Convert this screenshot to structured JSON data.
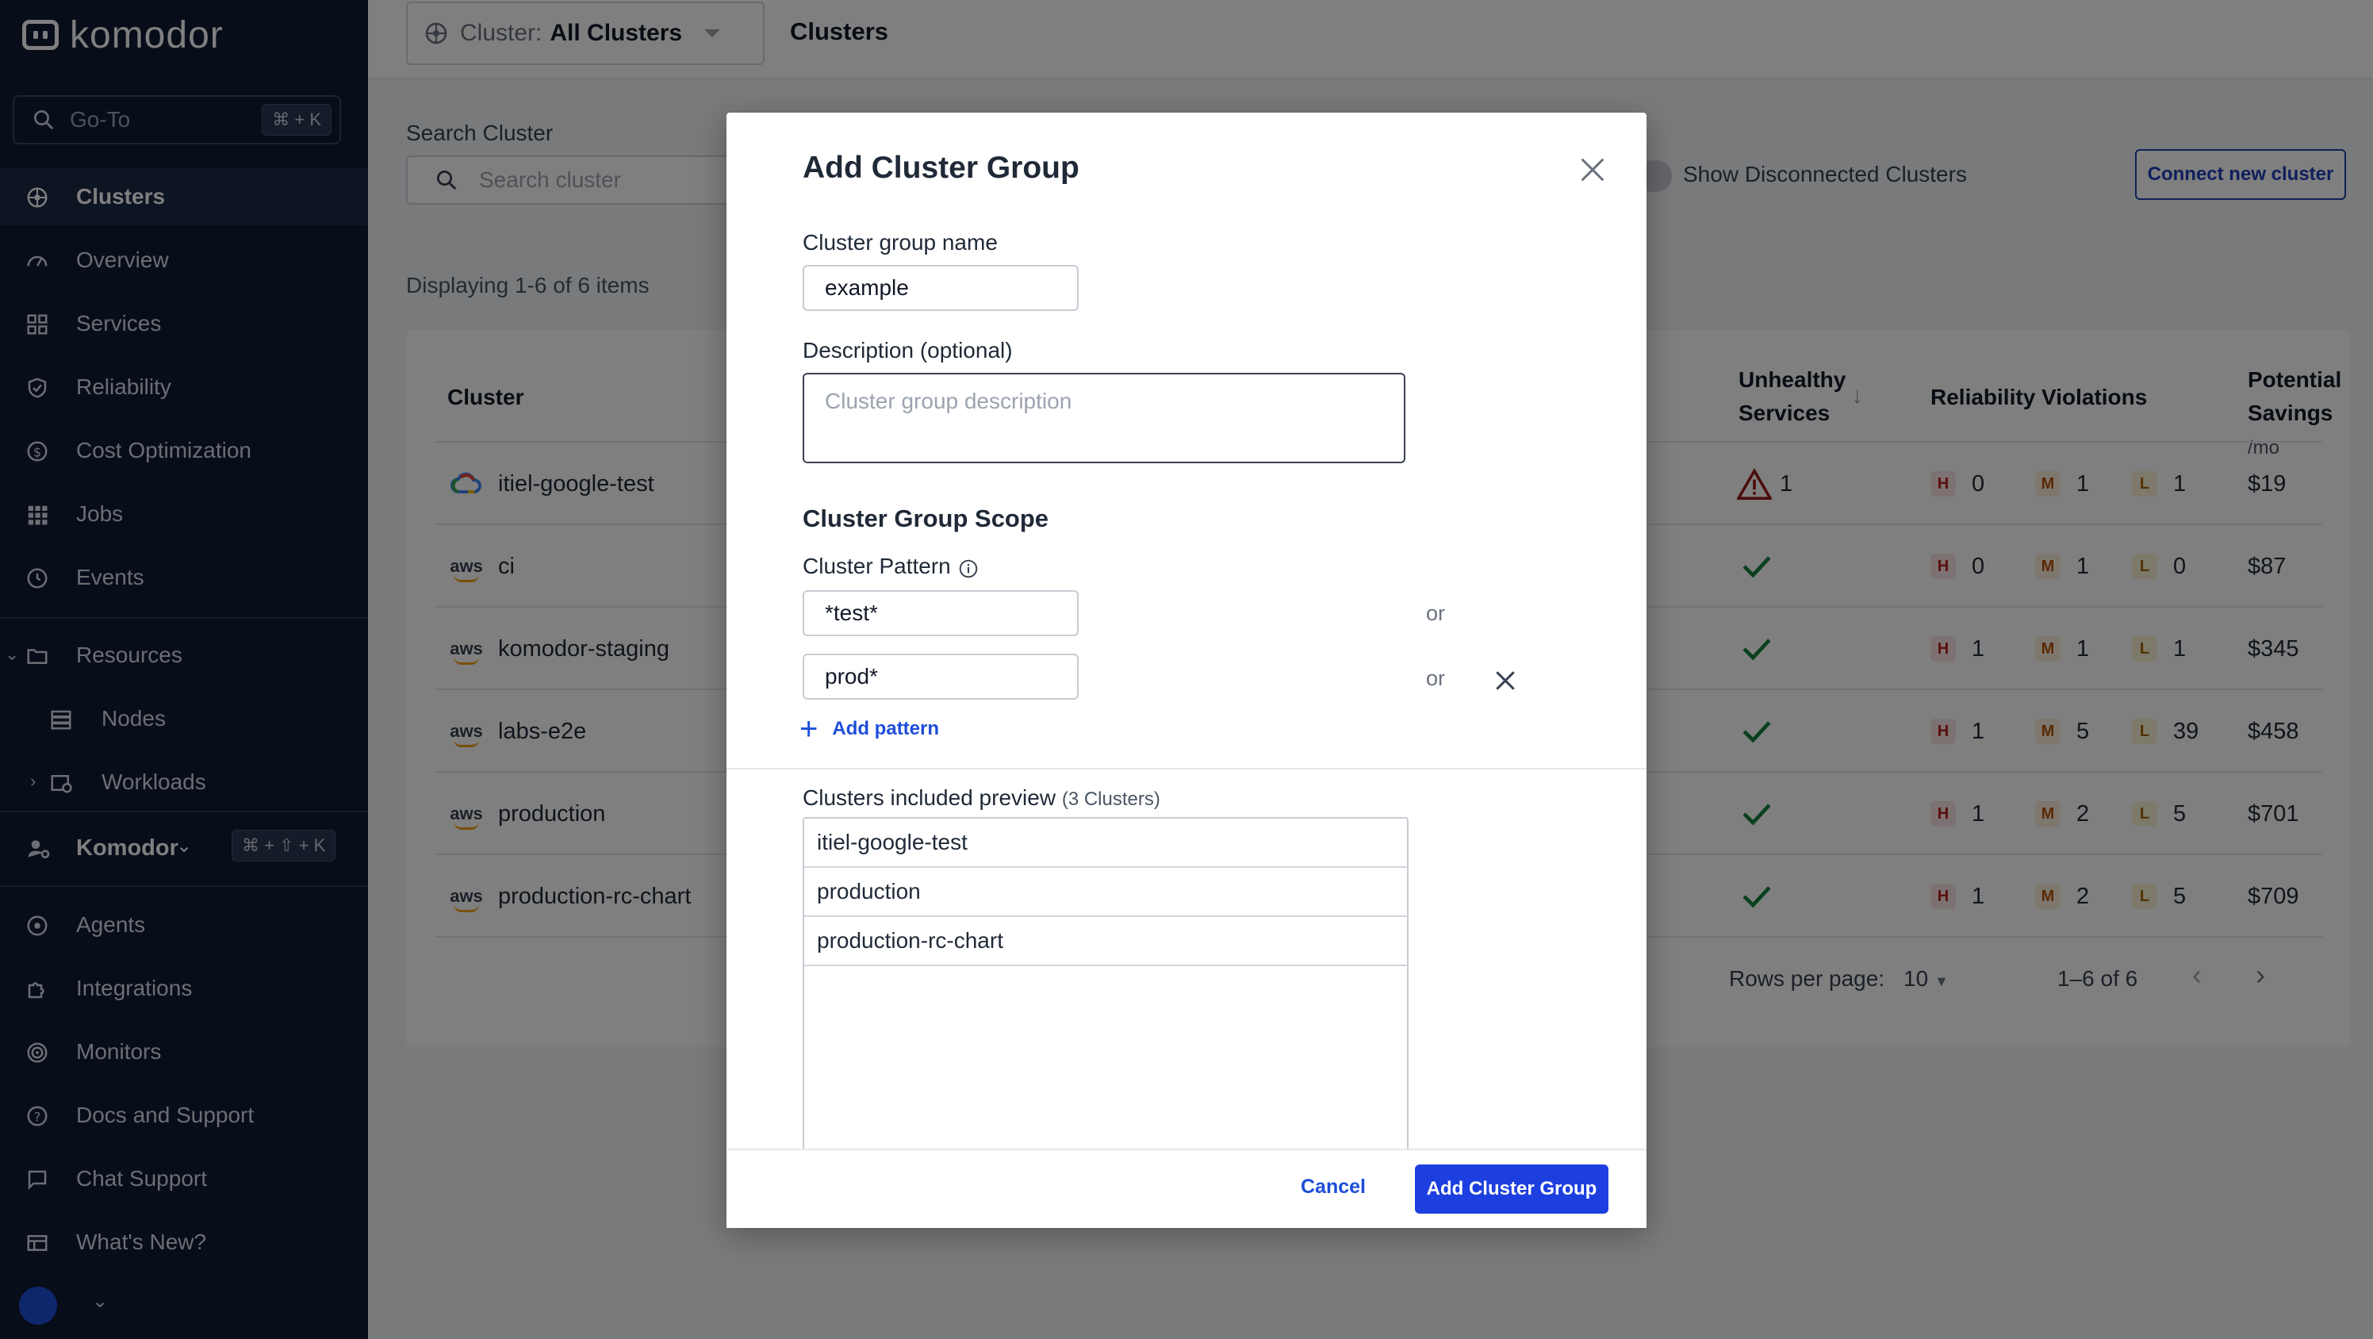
{
  "sidebar": {
    "logo": "komodor",
    "goto": {
      "placeholder": "Go-To",
      "shortcut": "⌘ + K"
    },
    "items": [
      {
        "label": "Clusters",
        "icon": "clusters-icon"
      },
      {
        "label": "Overview",
        "icon": "gauge-icon"
      },
      {
        "label": "Services",
        "icon": "grid-icon"
      },
      {
        "label": "Reliability",
        "icon": "shield-check-icon"
      },
      {
        "label": "Cost Optimization",
        "icon": "dollar-icon"
      },
      {
        "label": "Jobs",
        "icon": "dots-grid-icon"
      },
      {
        "label": "Events",
        "icon": "clock-icon"
      }
    ],
    "resources": {
      "label": "Resources",
      "children": [
        {
          "label": "Nodes"
        },
        {
          "label": "Workloads"
        }
      ]
    },
    "workspace": {
      "label": "Komodor",
      "shortcut": "⌘ + ⇧ + K"
    },
    "bottom_items": [
      {
        "label": "Agents"
      },
      {
        "label": "Integrations"
      },
      {
        "label": "Monitors"
      },
      {
        "label": "Docs and Support"
      },
      {
        "label": "Chat Support"
      },
      {
        "label": "What's New?"
      }
    ]
  },
  "topbar": {
    "cluster_prefix": "Cluster:",
    "cluster_value": "All Clusters",
    "title": "Clusters"
  },
  "filters": {
    "search_label": "Search Cluster",
    "search_placeholder": "Search cluster",
    "show_disconnected": "Show Disconnected Clusters",
    "connect_button": "Connect new cluster"
  },
  "table": {
    "displaying": "Displaying 1-6 of 6 items",
    "headers": {
      "cluster": "Cluster",
      "unhealthy_1": "Unhealthy",
      "unhealthy_2": "Services",
      "violations": "Reliability Violations",
      "savings_1": "Potential",
      "savings_2": "Savings",
      "savings_unit": "/mo"
    },
    "rows": [
      {
        "provider": "gcp",
        "name": "itiel-google-test",
        "unhealthy": "1",
        "h": "0",
        "m": "1",
        "l": "1",
        "savings": "$19"
      },
      {
        "provider": "aws",
        "name": "ci",
        "unhealthy": "",
        "h": "0",
        "m": "1",
        "l": "0",
        "savings": "$87"
      },
      {
        "provider": "aws",
        "name": "komodor-staging",
        "unhealthy": "",
        "h": "1",
        "m": "1",
        "l": "1",
        "savings": "$345"
      },
      {
        "provider": "aws",
        "name": "labs-e2e",
        "unhealthy": "",
        "h": "1",
        "m": "5",
        "l": "39",
        "savings": "$458"
      },
      {
        "provider": "aws",
        "name": "production",
        "unhealthy": "",
        "h": "1",
        "m": "2",
        "l": "5",
        "savings": "$701"
      },
      {
        "provider": "aws",
        "name": "production-rc-chart",
        "unhealthy": "",
        "h": "1",
        "m": "2",
        "l": "5",
        "savings": "$709"
      }
    ],
    "badge_letters": {
      "h": "H",
      "m": "M",
      "l": "L"
    },
    "aws_label": "aws",
    "pagination": {
      "rows_per_page_label": "Rows per page:",
      "rows_per_page": "10",
      "range": "1–6 of 6"
    }
  },
  "modal": {
    "title": "Add Cluster Group",
    "name_label": "Cluster group name",
    "name_value": "example",
    "description_label": "Description (optional)",
    "description_placeholder": "Cluster group description",
    "scope_title": "Cluster Group Scope",
    "pattern_label": "Cluster Pattern",
    "patterns": [
      "*test*",
      "prod*"
    ],
    "or_label": "or",
    "add_pattern": "Add pattern",
    "preview_label": "Clusters included preview",
    "preview_count": "(3 Clusters)",
    "preview_items": [
      "itiel-google-test",
      "production",
      "production-rc-chart"
    ],
    "cancel": "Cancel",
    "submit": "Add Cluster Group"
  },
  "colors": {
    "sidebar_bg": "#0f1b33",
    "primary": "#1d3fe0",
    "link": "#1d4ed8"
  }
}
